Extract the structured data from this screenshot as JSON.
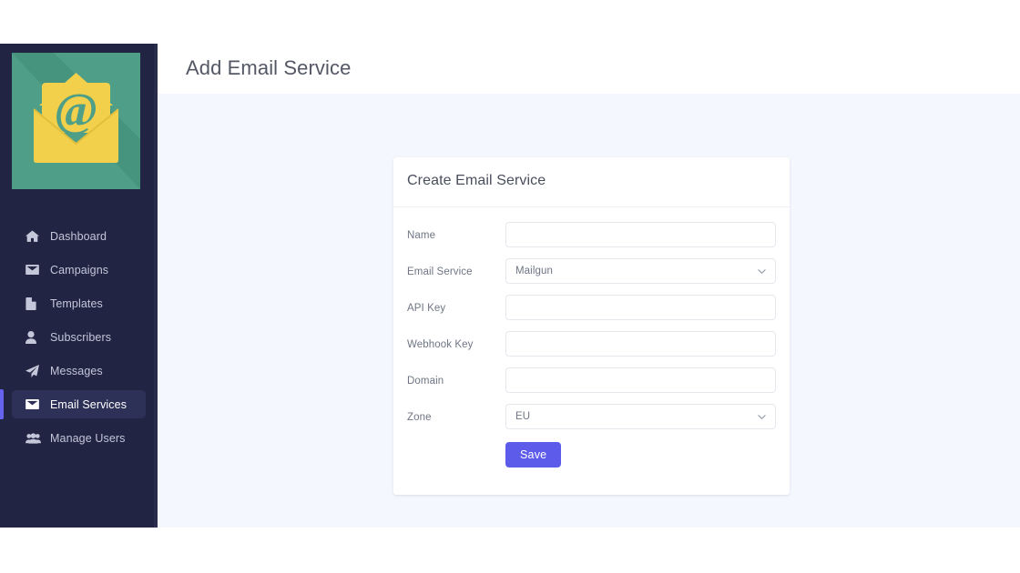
{
  "header": {
    "title": "Add Email Service"
  },
  "sidebar": {
    "logo_icon": "email-envelope-at-logo",
    "items": [
      {
        "label": "Dashboard",
        "icon": "home-icon",
        "active": false
      },
      {
        "label": "Campaigns",
        "icon": "envelope-icon",
        "active": false
      },
      {
        "label": "Templates",
        "icon": "document-icon",
        "active": false
      },
      {
        "label": "Subscribers",
        "icon": "user-icon",
        "active": false
      },
      {
        "label": "Messages",
        "icon": "paper-plane-icon",
        "active": false
      },
      {
        "label": "Email Services",
        "icon": "envelope-open-icon",
        "active": true
      },
      {
        "label": "Manage Users",
        "icon": "users-group-icon",
        "active": false
      }
    ]
  },
  "card": {
    "title": "Create Email Service",
    "fields": [
      {
        "label": "Name",
        "type": "text",
        "value": "",
        "placeholder": ""
      },
      {
        "label": "Email Service",
        "type": "select",
        "value": "Mailgun",
        "options": [
          "Mailgun"
        ]
      },
      {
        "label": "API Key",
        "type": "text",
        "value": "",
        "placeholder": ""
      },
      {
        "label": "Webhook Key",
        "type": "text",
        "value": "",
        "placeholder": ""
      },
      {
        "label": "Domain",
        "type": "text",
        "value": "",
        "placeholder": ""
      },
      {
        "label": "Zone",
        "type": "select",
        "value": "EU",
        "options": [
          "EU"
        ]
      }
    ],
    "save_label": "Save"
  },
  "colors": {
    "sidebar_bg": "#212443",
    "sidebar_active_bg": "#2d3157",
    "accent": "#6563ef",
    "primary_button": "#5d5bea",
    "content_bg": "#f4f7fd",
    "logo_green": "#4f9e87",
    "logo_yellow": "#f2d04b"
  }
}
